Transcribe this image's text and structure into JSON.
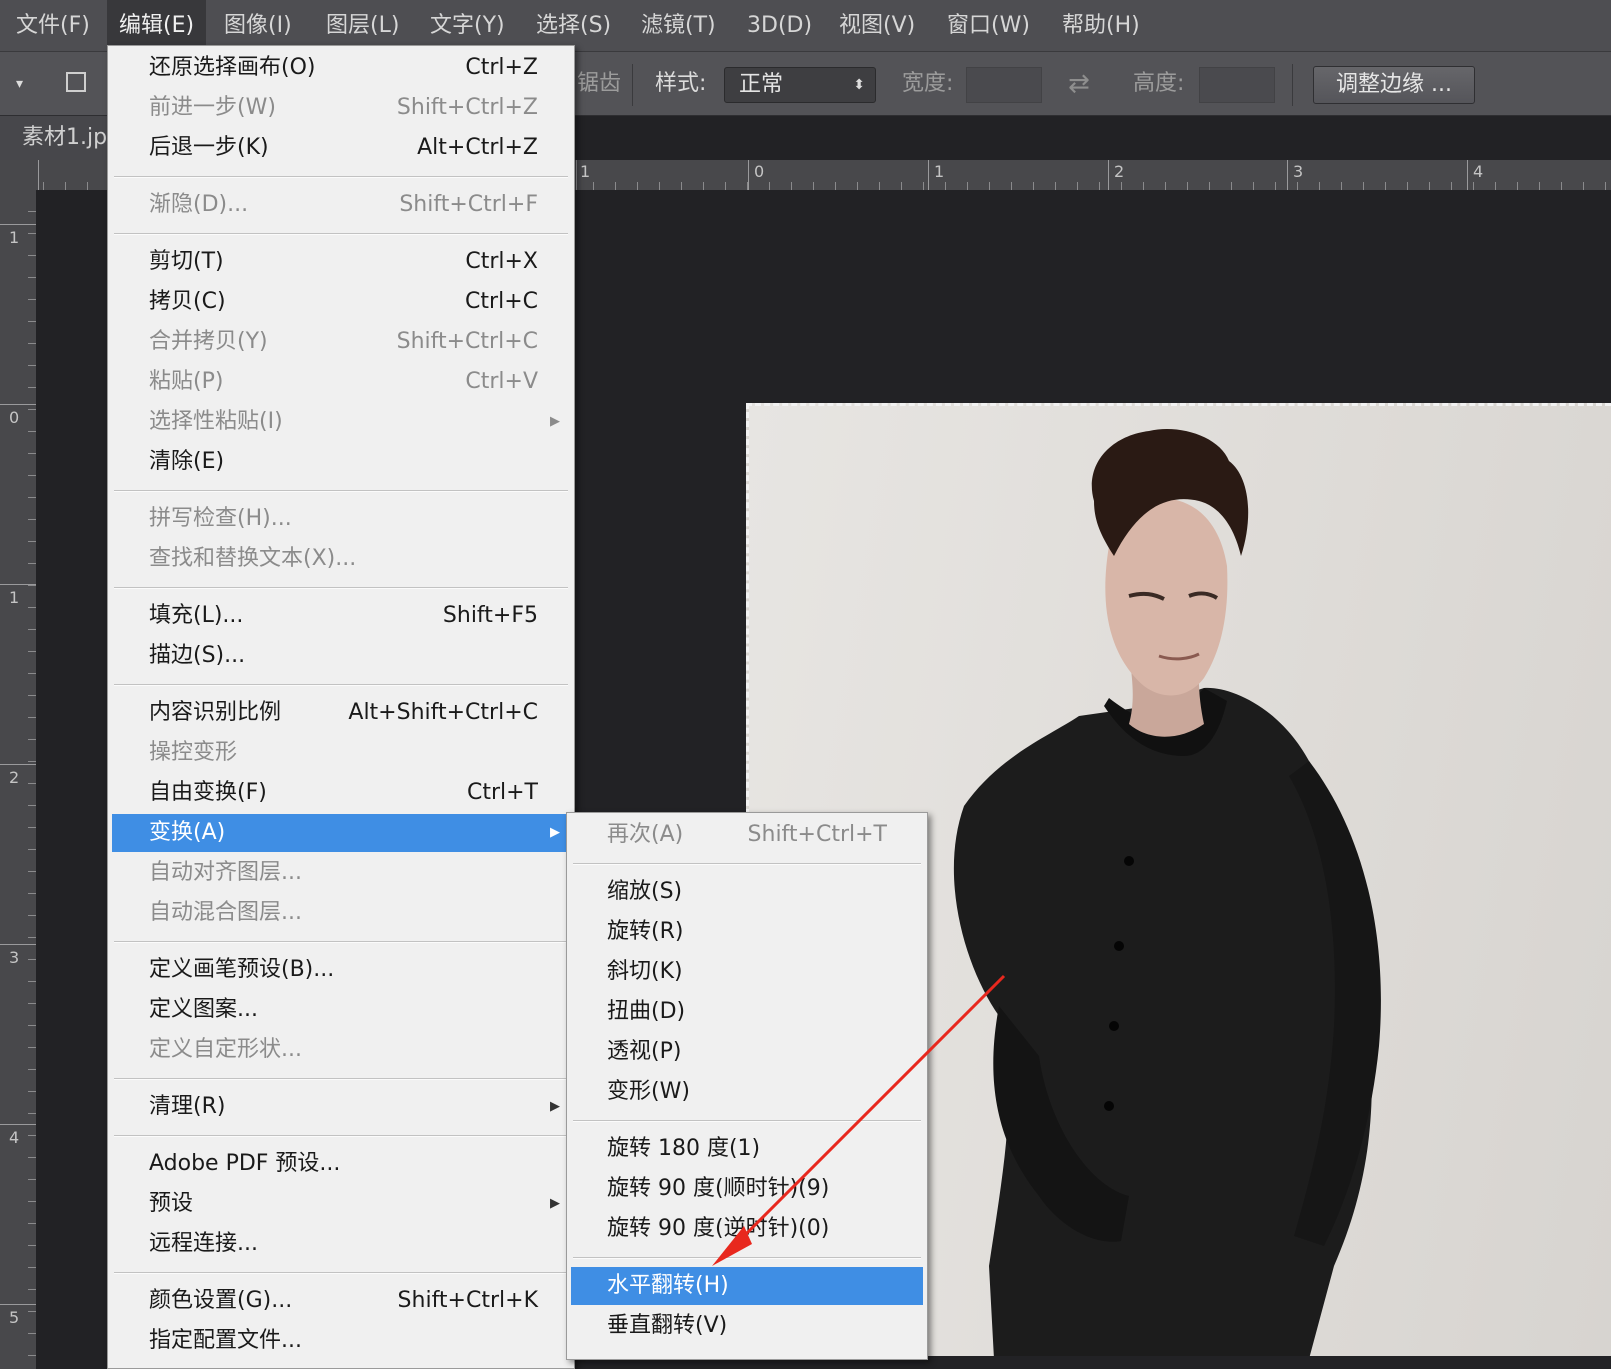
{
  "menubar": {
    "items": [
      {
        "label": "文件(F)"
      },
      {
        "label": "编辑(E)"
      },
      {
        "label": "图像(I)"
      },
      {
        "label": "图层(L)"
      },
      {
        "label": "文字(Y)"
      },
      {
        "label": "选择(S)"
      },
      {
        "label": "滤镜(T)"
      },
      {
        "label": "3D(D)"
      },
      {
        "label": "视图(V)"
      },
      {
        "label": "窗口(W)"
      },
      {
        "label": "帮助(H)"
      }
    ]
  },
  "options": {
    "antialias_partial": "锯齿",
    "style_label": "样式:",
    "style_value": "正常",
    "width_label": "宽度:",
    "height_label": "高度:",
    "refine_button": "调整边缘 ..."
  },
  "document": {
    "tab_label": "素材1.jp"
  },
  "rulers": {
    "top": [
      "1",
      "0",
      "1",
      "2",
      "3",
      "4"
    ],
    "left": [
      "1",
      "0",
      "1",
      "2",
      "3",
      "4",
      "5"
    ]
  },
  "edit_menu": {
    "items": [
      {
        "label": "还原选择画布(O)",
        "shortcut": "Ctrl+Z"
      },
      {
        "label": "前进一步(W)",
        "shortcut": "Shift+Ctrl+Z"
      },
      {
        "label": "后退一步(K)",
        "shortcut": "Alt+Ctrl+Z"
      },
      {
        "label": "渐隐(D)...",
        "shortcut": "Shift+Ctrl+F"
      },
      {
        "label": "剪切(T)",
        "shortcut": "Ctrl+X"
      },
      {
        "label": "拷贝(C)",
        "shortcut": "Ctrl+C"
      },
      {
        "label": "合并拷贝(Y)",
        "shortcut": "Shift+Ctrl+C"
      },
      {
        "label": "粘贴(P)",
        "shortcut": "Ctrl+V"
      },
      {
        "label": "选择性粘贴(I)",
        "shortcut": ""
      },
      {
        "label": "清除(E)",
        "shortcut": ""
      },
      {
        "label": "拼写检查(H)...",
        "shortcut": ""
      },
      {
        "label": "查找和替换文本(X)...",
        "shortcut": ""
      },
      {
        "label": "填充(L)...",
        "shortcut": "Shift+F5"
      },
      {
        "label": "描边(S)...",
        "shortcut": ""
      },
      {
        "label": "内容识别比例",
        "shortcut": "Alt+Shift+Ctrl+C"
      },
      {
        "label": "操控变形",
        "shortcut": ""
      },
      {
        "label": "自由变换(F)",
        "shortcut": "Ctrl+T"
      },
      {
        "label": "变换(A)",
        "shortcut": ""
      },
      {
        "label": "自动对齐图层...",
        "shortcut": ""
      },
      {
        "label": "自动混合图层...",
        "shortcut": ""
      },
      {
        "label": "定义画笔预设(B)...",
        "shortcut": ""
      },
      {
        "label": "定义图案...",
        "shortcut": ""
      },
      {
        "label": "定义自定形状...",
        "shortcut": ""
      },
      {
        "label": "清理(R)",
        "shortcut": ""
      },
      {
        "label": "Adobe PDF 预设...",
        "shortcut": ""
      },
      {
        "label": "预设",
        "shortcut": ""
      },
      {
        "label": "远程连接...",
        "shortcut": ""
      },
      {
        "label": "颜色设置(G)...",
        "shortcut": "Shift+Ctrl+K"
      },
      {
        "label": "指定配置文件...",
        "shortcut": ""
      }
    ]
  },
  "transform_menu": {
    "items": [
      {
        "label": "再次(A)",
        "shortcut": "Shift+Ctrl+T"
      },
      {
        "label": "缩放(S)",
        "shortcut": ""
      },
      {
        "label": "旋转(R)",
        "shortcut": ""
      },
      {
        "label": "斜切(K)",
        "shortcut": ""
      },
      {
        "label": "扭曲(D)",
        "shortcut": ""
      },
      {
        "label": "透视(P)",
        "shortcut": ""
      },
      {
        "label": "变形(W)",
        "shortcut": ""
      },
      {
        "label": "旋转 180 度(1)",
        "shortcut": ""
      },
      {
        "label": "旋转 90 度(顺时针)(9)",
        "shortcut": ""
      },
      {
        "label": "旋转 90 度(逆时针)(0)",
        "shortcut": ""
      },
      {
        "label": "水平翻转(H)",
        "shortcut": ""
      },
      {
        "label": "垂直翻转(V)",
        "shortcut": ""
      }
    ]
  },
  "colors": {
    "highlight": "#3f8ee4",
    "annotation_arrow": "#e8281e"
  }
}
